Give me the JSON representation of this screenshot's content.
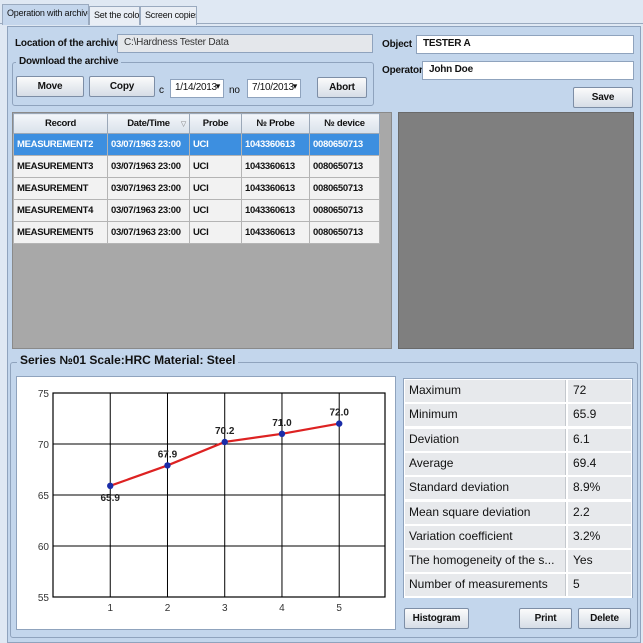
{
  "tabs": [
    {
      "label": "Operation with archive",
      "active": true
    },
    {
      "label": "Set the color",
      "active": false
    },
    {
      "label": "Screen copies",
      "active": false
    }
  ],
  "archive": {
    "location_label": "Location of the archive",
    "location_value": "C:\\Hardness Tester Data",
    "download_title": "Download the archive",
    "move_label": "Move",
    "copy_label": "Copy",
    "from_label": "c",
    "date_from": "1/14/2013",
    "to_label": "no",
    "date_to": "7/10/2013",
    "abort_label": "Abort"
  },
  "meta": {
    "object_label": "Object",
    "object_value": "TESTER A",
    "operator_label": "Operator",
    "operator_value": "John Doe",
    "save_label": "Save"
  },
  "grid": {
    "columns": [
      "Record",
      "Date/Time",
      "Probe",
      "№ Probe",
      "№ device"
    ],
    "rows": [
      {
        "record": "MEASUREMENT2",
        "datetime": "03/07/1963 23:00",
        "probe": "UCI",
        "probe_no": "1043360613",
        "device_no": "0080650713",
        "selected": true
      },
      {
        "record": "MEASUREMENT3",
        "datetime": "03/07/1963 23:00",
        "probe": "UCI",
        "probe_no": "1043360613",
        "device_no": "0080650713",
        "selected": false
      },
      {
        "record": "MEASUREMENT",
        "datetime": "03/07/1963 23:00",
        "probe": "UCI",
        "probe_no": "1043360613",
        "device_no": "0080650713",
        "selected": false
      },
      {
        "record": "MEASUREMENT4",
        "datetime": "03/07/1963 23:00",
        "probe": "UCI",
        "probe_no": "1043360613",
        "device_no": "0080650713",
        "selected": false
      },
      {
        "record": "MEASUREMENT5",
        "datetime": "03/07/1963 23:00",
        "probe": "UCI",
        "probe_no": "1043360613",
        "device_no": "0080650713",
        "selected": false
      }
    ]
  },
  "series": {
    "title": "Series №01 Scale:HRC Material: Steel"
  },
  "chart_data": {
    "type": "line",
    "x": [
      1,
      2,
      3,
      4,
      5
    ],
    "series": [
      {
        "values": [
          65.9,
          67.9,
          70.2,
          71.0,
          72.0
        ],
        "data_labels": [
          "65.9",
          "67.9",
          "70.2",
          "71.0",
          "72.0"
        ]
      }
    ],
    "xticks": [
      "1",
      "2",
      "3",
      "4",
      "5"
    ],
    "yticks": [
      "55",
      "60",
      "65",
      "70",
      "75"
    ],
    "xlim": [
      0,
      5.8
    ],
    "ylim": [
      55,
      75
    ],
    "grid": true,
    "line_color": "#dd2222",
    "marker_color": "#1a2ca8"
  },
  "stats": [
    {
      "name": "Maximum",
      "value": "72"
    },
    {
      "name": "Minimum",
      "value": "65.9"
    },
    {
      "name": "Deviation",
      "value": "6.1"
    },
    {
      "name": "Average",
      "value": "69.4"
    },
    {
      "name": "Standard deviation",
      "value": "8.9%"
    },
    {
      "name": "Mean square deviation",
      "value": "2.2"
    },
    {
      "name": "Variation coefficient",
      "value": "3.2%"
    },
    {
      "name": "The homogeneity of the s...",
      "value": "Yes"
    },
    {
      "name": "Number of measurements",
      "value": "5"
    }
  ],
  "actions": {
    "histogram_label": "Histogram",
    "print_label": "Print",
    "delete_label": "Delete"
  }
}
